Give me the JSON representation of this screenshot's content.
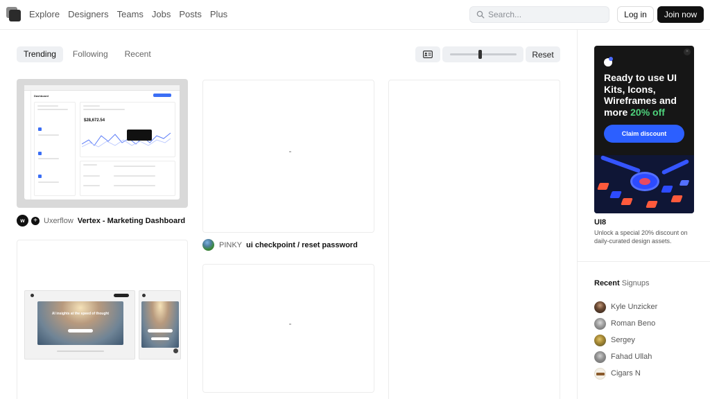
{
  "nav": {
    "items": [
      "Explore",
      "Designers",
      "Teams",
      "Jobs",
      "Posts",
      "Plus"
    ]
  },
  "search": {
    "placeholder": "Search..."
  },
  "auth": {
    "login_label": "Log in",
    "join_label": "Join now"
  },
  "filters": {
    "tabs": [
      "Trending",
      "Following",
      "Recent"
    ],
    "active_tab": "Trending",
    "reset_label": "Reset",
    "zoom_level": 0.45
  },
  "shots": [
    {
      "author": "Uxerflow",
      "title": "Vertex - Marketing Dashboard",
      "thumb_header": "Dashboard",
      "thumb_value": "$28,672.54"
    },
    {
      "author": "PINKY",
      "title": "ui checkpoint / reset password"
    },
    {
      "author": "",
      "title": "",
      "thumb_hero_text": "AI insights at the speed of thought"
    }
  ],
  "ad": {
    "headline_1": "Ready to use UI Kits, Icons, Wireframes and more",
    "headline_2": "20% off",
    "cta_label": "Claim discount",
    "close_glyph": "×",
    "sponsor": "UI8",
    "description": "Unlock a special 20% discount on daily-curated design assets.",
    "accent_color": "#2c5fff",
    "highlight_color": "#4ed37c"
  },
  "recent_signups": {
    "title_1": "Recent",
    "title_2": "Signups",
    "users": [
      {
        "name": "Kyle Unzicker",
        "avatar_color": "#3a2b22"
      },
      {
        "name": "Roman Beno",
        "avatar_color": "#8d8d8d"
      },
      {
        "name": "Sergey",
        "avatar_color": "#7a6a2a"
      },
      {
        "name": "Fahad Ullah",
        "avatar_color": "#9a9a9a"
      },
      {
        "name": "Cigars N",
        "avatar_color": "#f3efe6"
      }
    ]
  }
}
